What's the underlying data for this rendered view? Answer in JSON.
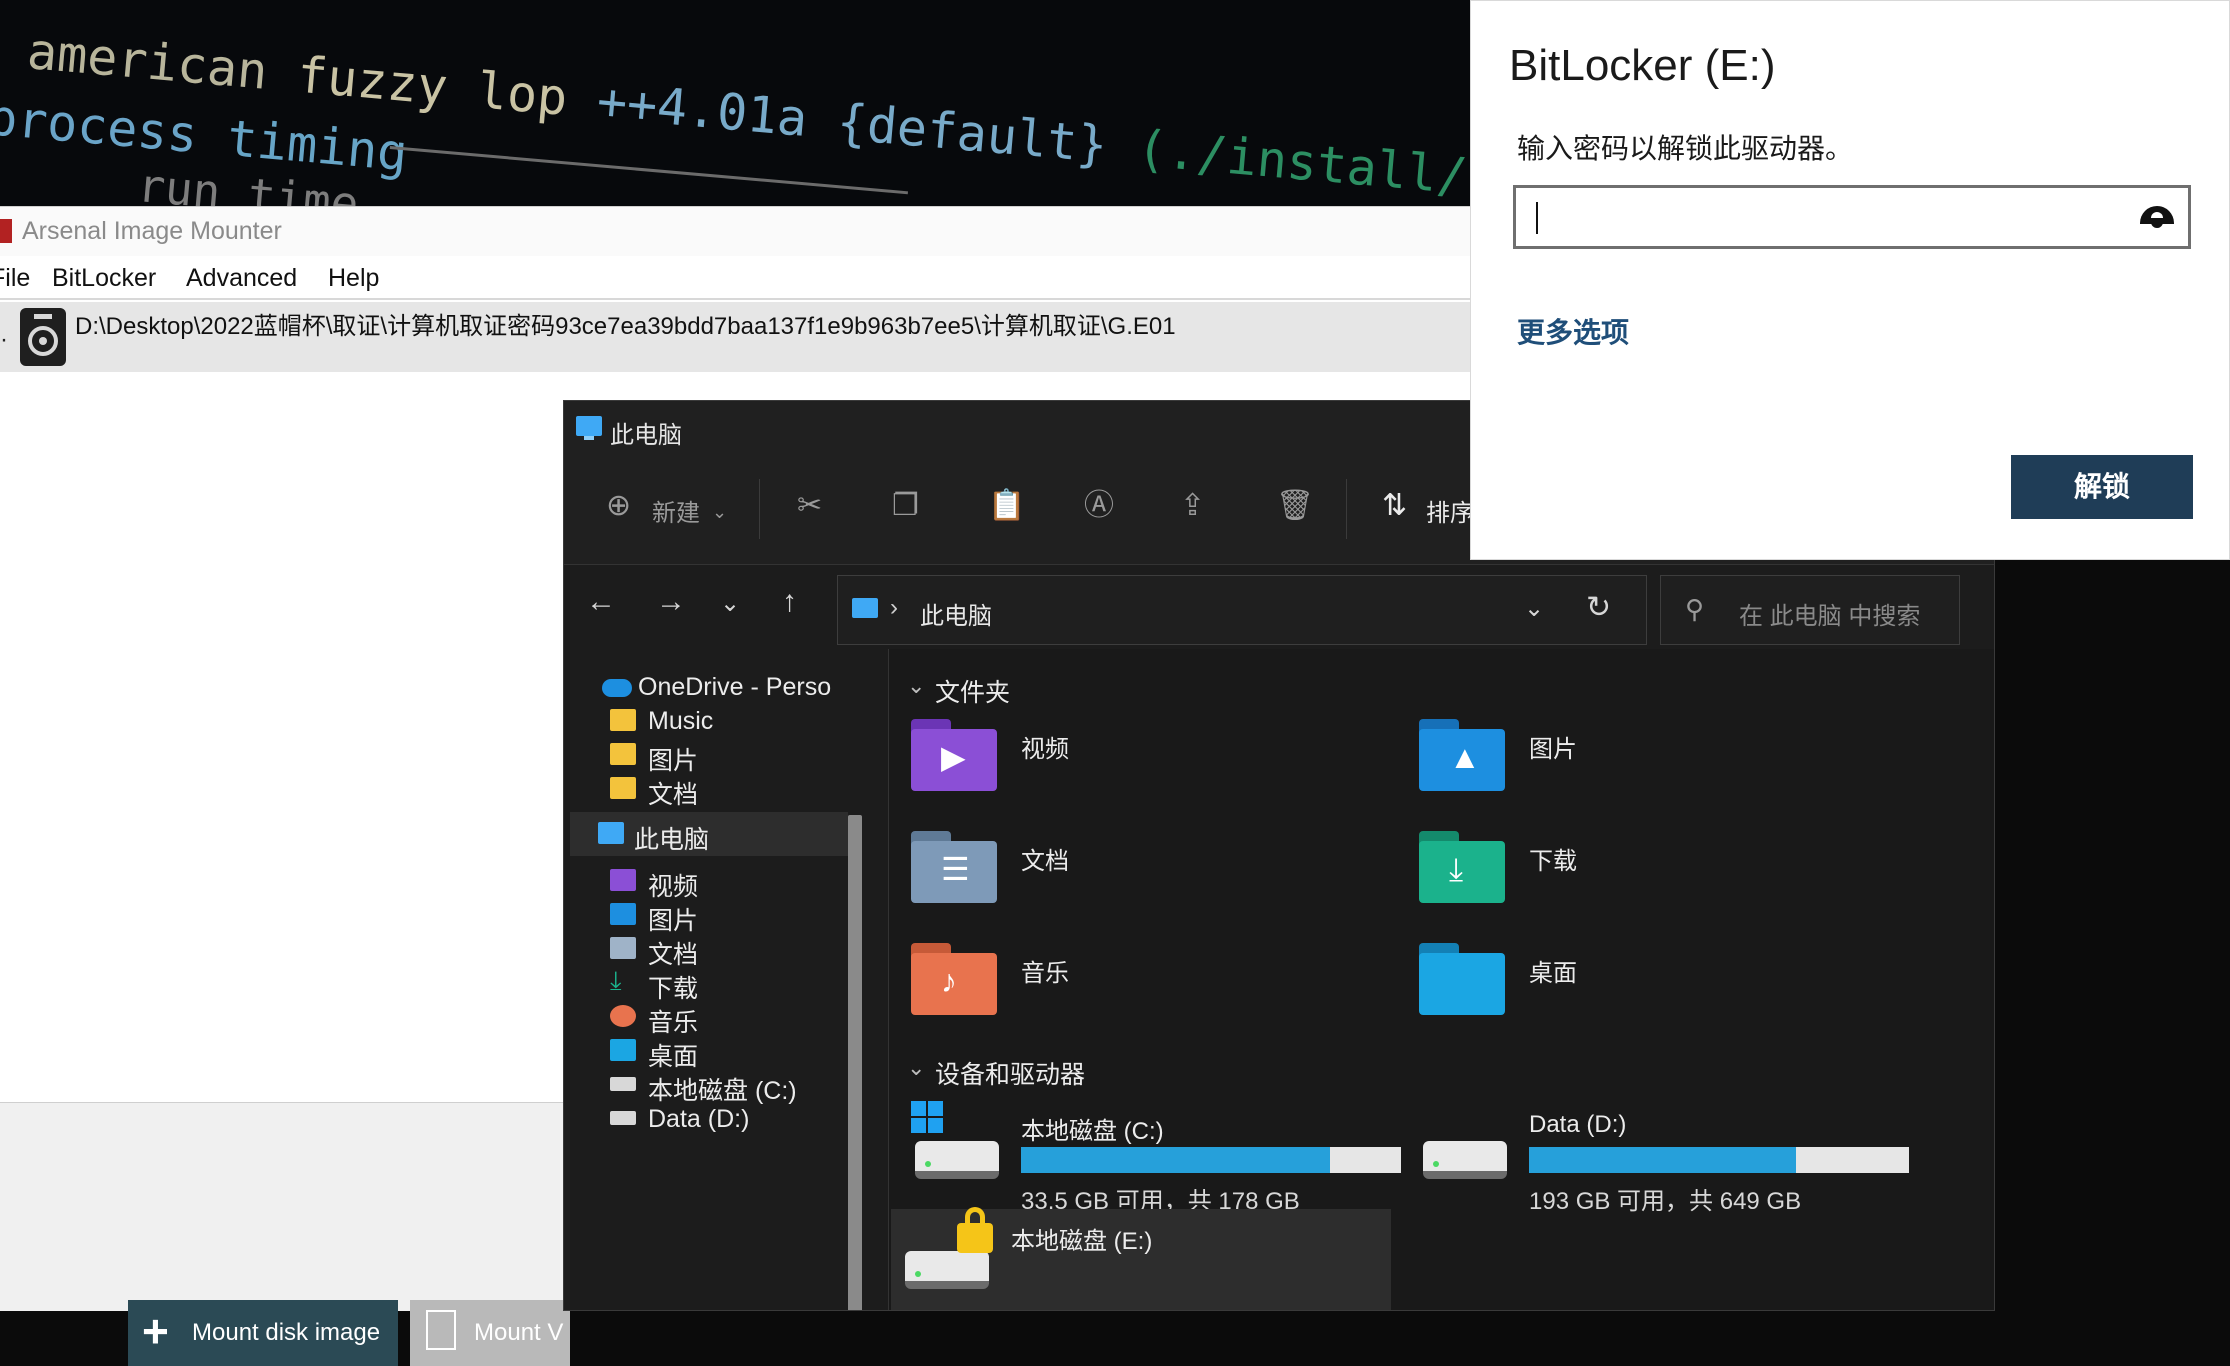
{
  "terminal": {
    "line1_a": "american",
    "line1_b": "fuzzy lop",
    "line1_c": "++4.01a",
    "line1_d": "{default}",
    "line1_e": "(./install/",
    "line2_a": "process",
    "line2_b": "timing",
    "line3_a": "run time"
  },
  "aim": {
    "title": "Arsenal Image Mounter",
    "menu": [
      "File",
      "BitLocker",
      "Advanced",
      "Help"
    ],
    "image_path": "D:\\Desktop\\2022蓝帽杯\\取证\\计算机取证密码93ce7ea39bdd7baa137f1e9b963b7ee5\\计算机取证\\G.E01",
    "buttons": {
      "mount": "Mount disk image",
      "mount2": "Mount V"
    }
  },
  "explorer": {
    "title": "此电脑",
    "toolbar": {
      "new_label": "新建",
      "sort_label": "排序"
    },
    "address": "此电脑",
    "search_placeholder": "在 此电脑 中搜索",
    "nav_items": [
      {
        "label": "OneDrive - Perso",
        "icon": "onedrive-icon"
      },
      {
        "label": "Music",
        "icon": "folder-icon"
      },
      {
        "label": "图片",
        "icon": "folder-icon"
      },
      {
        "label": "文档",
        "icon": "folder-icon"
      },
      {
        "label": "此电脑",
        "icon": "this-pc-icon",
        "selected": true
      },
      {
        "label": "视频",
        "icon": "videos-icon"
      },
      {
        "label": "图片",
        "icon": "pictures-icon"
      },
      {
        "label": "文档",
        "icon": "documents-icon"
      },
      {
        "label": "下载",
        "icon": "downloads-icon"
      },
      {
        "label": "音乐",
        "icon": "music-icon"
      },
      {
        "label": "桌面",
        "icon": "desktop-icon"
      },
      {
        "label": "本地磁盘 (C:)",
        "icon": "drive-icon"
      },
      {
        "label": "Data (D:)",
        "icon": "drive-icon"
      }
    ],
    "folders_header": "文件夹",
    "folders": [
      {
        "label": "视频",
        "color": "#8b4fd6"
      },
      {
        "label": "图片",
        "color": "#1d8fe0"
      },
      {
        "label": "文档",
        "color": "#7e9ab8"
      },
      {
        "label": "下载",
        "color": "#1bb28c"
      },
      {
        "label": "音乐",
        "color": "#e8734e"
      },
      {
        "label": "桌面",
        "color": "#1ba6e3"
      }
    ],
    "drives_header": "设备和驱动器",
    "drives": [
      {
        "name": "本地磁盘 (C:)",
        "free": "33.5 GB 可用，共 178 GB",
        "used_fraction": 0.812
      },
      {
        "name": "Data (D:)",
        "free": "193 GB 可用，共 649 GB",
        "used_fraction": 0.703
      },
      {
        "name": "本地磁盘 (E:)",
        "locked": true
      }
    ]
  },
  "bitlocker": {
    "title": "BitLocker (E:)",
    "prompt": "输入密码以解锁此驱动器。",
    "more_options": "更多选项",
    "unlock": "解锁"
  },
  "colors": {
    "accent": "#26a0da",
    "bitlocker_button": "#1f3d57",
    "aim_button": "#2b4a55"
  }
}
